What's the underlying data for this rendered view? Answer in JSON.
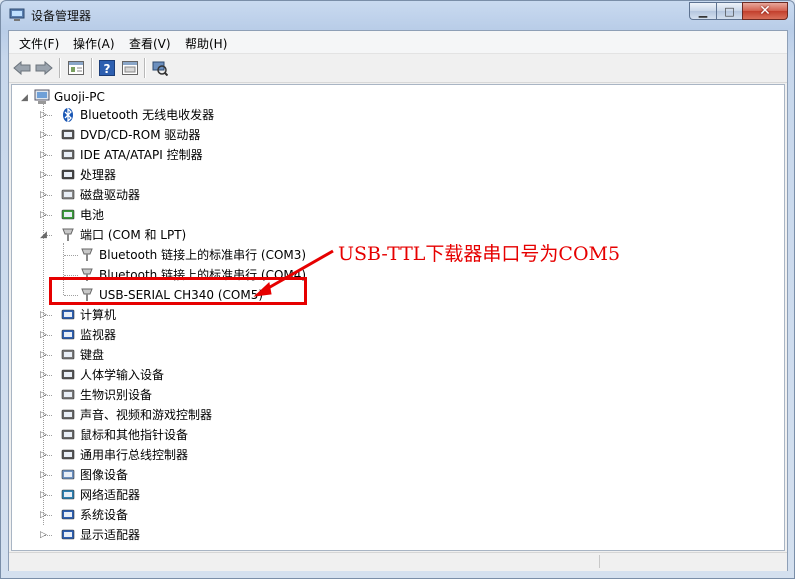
{
  "window": {
    "title": "设备管理器"
  },
  "menu": [
    "文件(F)",
    "操作(A)",
    "查看(V)",
    "帮助(H)"
  ],
  "toolbar_icons": [
    "back-arrow-icon",
    "forward-arrow-icon",
    "properties-icon",
    "help-icon",
    "update-driver-icon",
    "scan-hardware-icon"
  ],
  "tree": {
    "root": "Guoji-PC",
    "categories": [
      "Bluetooth 无线电收发器",
      "DVD/CD-ROM 驱动器",
      "IDE ATA/ATAPI 控制器",
      "处理器",
      "磁盘驱动器",
      "电池",
      "端口 (COM 和 LPT)",
      "计算机",
      "监视器",
      "键盘",
      "人体学输入设备",
      "生物识别设备",
      "声音、视频和游戏控制器",
      "鼠标和其他指针设备",
      "通用串行总线控制器",
      "图像设备",
      "网络适配器",
      "系统设备",
      "显示适配器"
    ],
    "ports": [
      "Bluetooth 链接上的标准串行 (COM3)",
      "Bluetooth 链接上的标准串行 (COM4)",
      "USB-SERIAL CH340 (COM5)"
    ]
  },
  "annotation": {
    "text": "USB-TTL下载器串口号为COM5",
    "color": "#e60000"
  }
}
